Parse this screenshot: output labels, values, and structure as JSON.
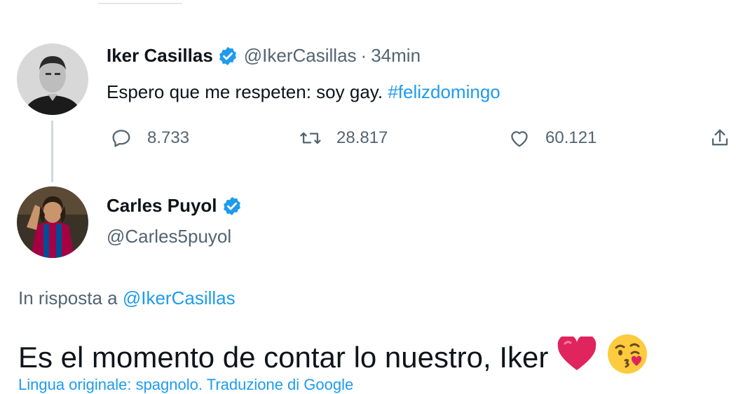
{
  "tweet1": {
    "author_name": "Iker Casillas",
    "handle": "@IkerCasillas",
    "separator": "·",
    "time": "34min",
    "text": "Espero que me respeten: soy gay. ",
    "hashtag": "#felizdomingo",
    "actions": {
      "replies": "8.733",
      "retweets": "28.817",
      "likes": "60.121"
    }
  },
  "tweet2": {
    "author_name": "Carles Puyol",
    "handle": "@Carles5puyol",
    "reply_prefix": "In risposta a ",
    "reply_mention": "@IkerCasillas",
    "text": "Es el momento de contar lo nuestro, Iker",
    "translate_text": "Lingua originale: spagnolo. Traduzione di Google"
  },
  "colors": {
    "accent": "#1d9bf0",
    "secondary_text": "#536471",
    "heart": "#e0245e"
  },
  "icons": [
    "verified-badge-icon",
    "reply-icon",
    "retweet-icon",
    "like-icon",
    "share-icon",
    "red-heart-emoji",
    "kiss-emoji"
  ]
}
